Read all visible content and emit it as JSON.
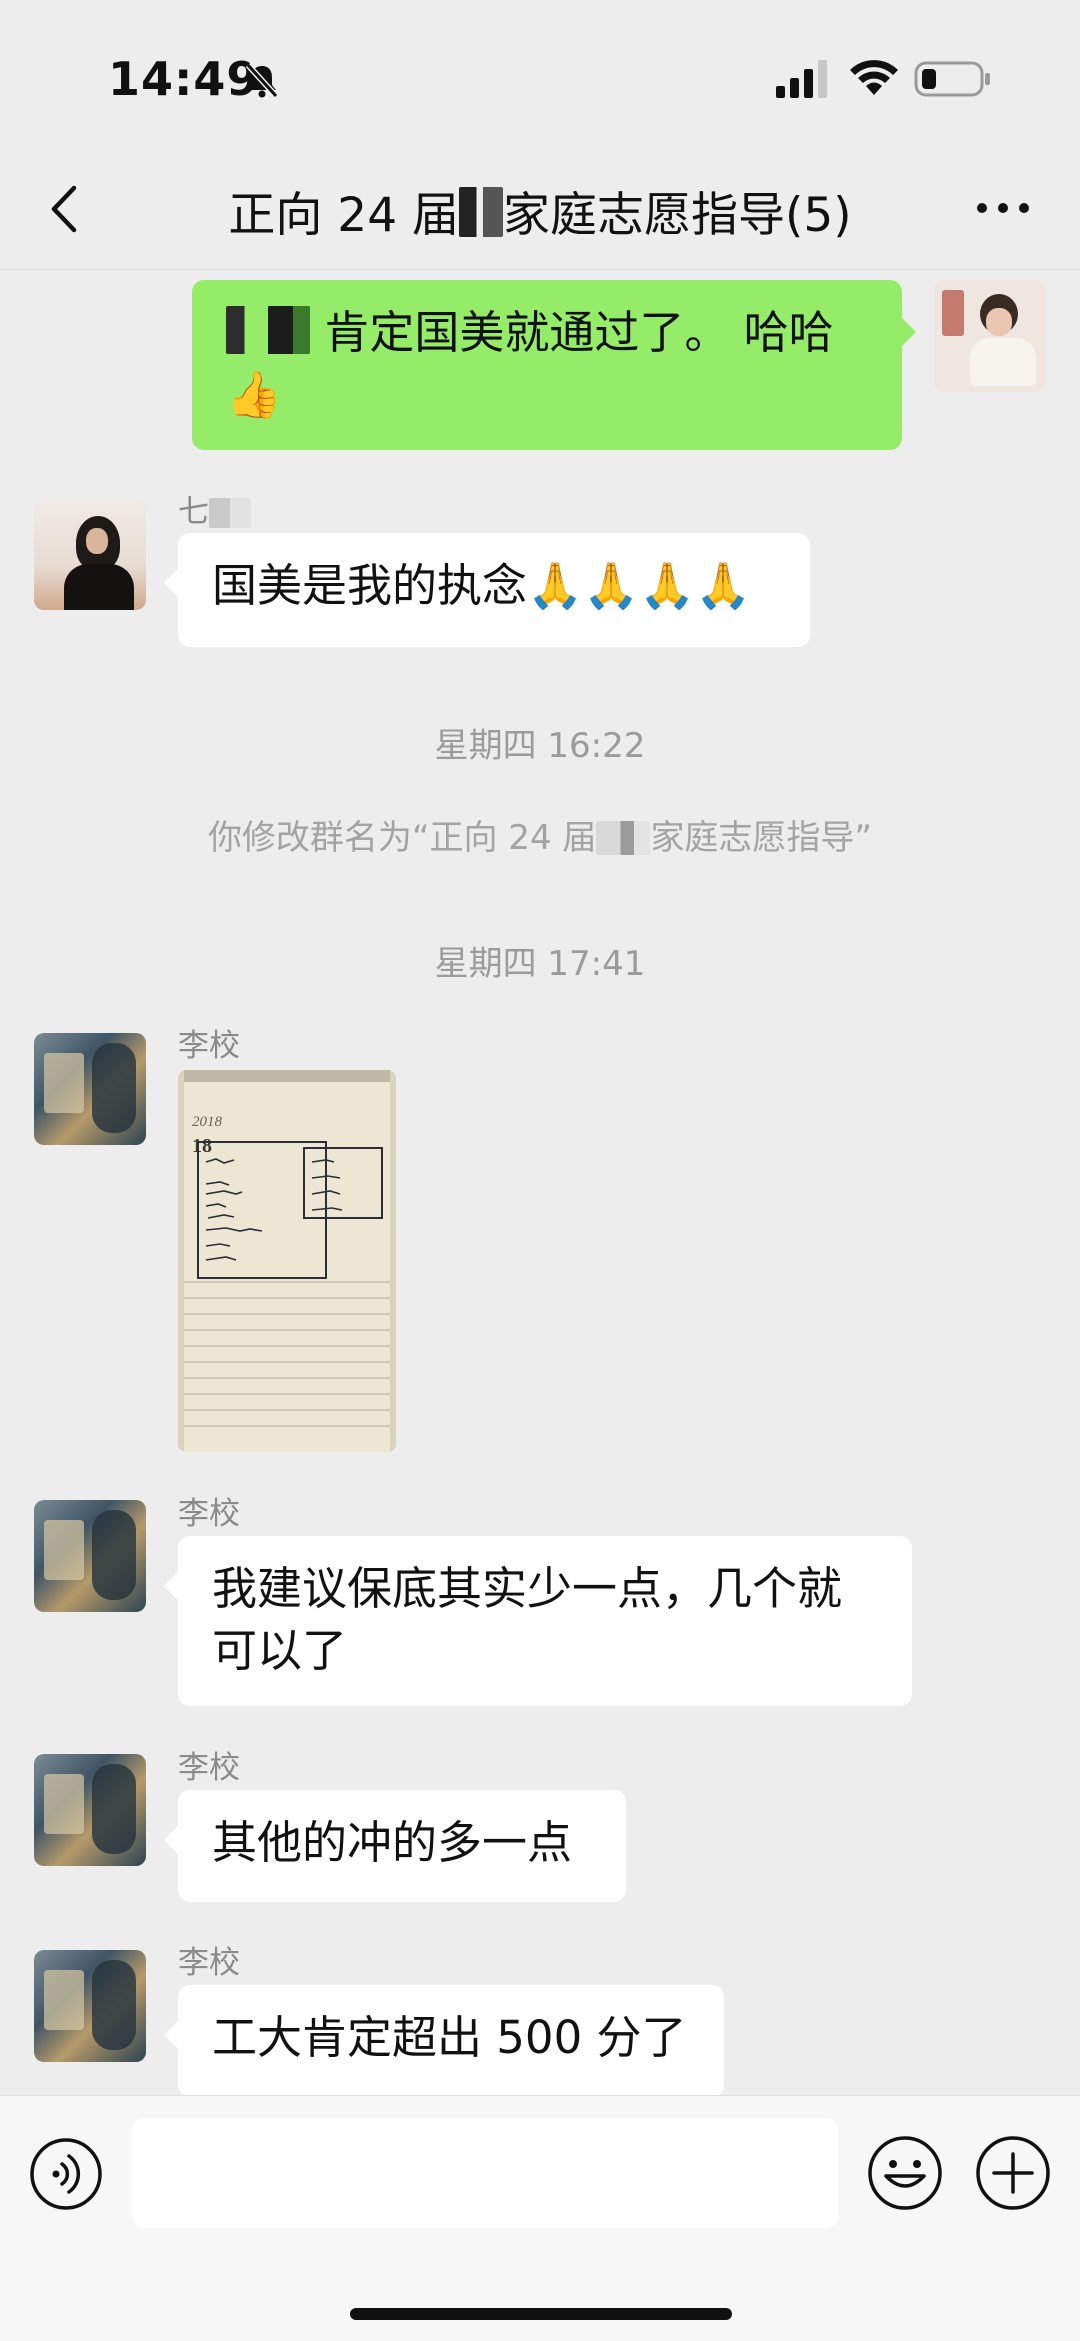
{
  "status": {
    "time": "14:49"
  },
  "nav": {
    "title": "正向 24 届",
    "title_suffix": "家庭志愿指导(5)"
  },
  "messages": {
    "m1": {
      "text": "肯定国美就通过了。 哈哈 👍"
    },
    "m2": {
      "sender": "七",
      "text": "国美是我的执念🙏🙏🙏🙏"
    },
    "ts1": "星期四 16:22",
    "sys1": {
      "prefix": "你修改群名为“正向 24 届",
      "suffix": "家庭志愿指导”"
    },
    "ts2": "星期四 17:41",
    "m3": {
      "sender": "李校",
      "photo_year": "2018",
      "photo_day": "18"
    },
    "m4": {
      "sender": "李校",
      "text": "我建议保底其实少一点，几个就可以了"
    },
    "m5": {
      "sender": "李校",
      "text": "其他的冲的多一点"
    },
    "m6": {
      "sender": "李校",
      "text": "工大肯定超出 500 分了"
    }
  },
  "colors": {
    "self_bubble": "#95ec69",
    "other_bubble": "#ffffff",
    "background": "#ededed"
  },
  "icons": {
    "back": "chevron-left-icon",
    "more": "more-icon",
    "voice": "voice-icon",
    "emoji": "emoji-icon",
    "plus": "plus-icon"
  }
}
